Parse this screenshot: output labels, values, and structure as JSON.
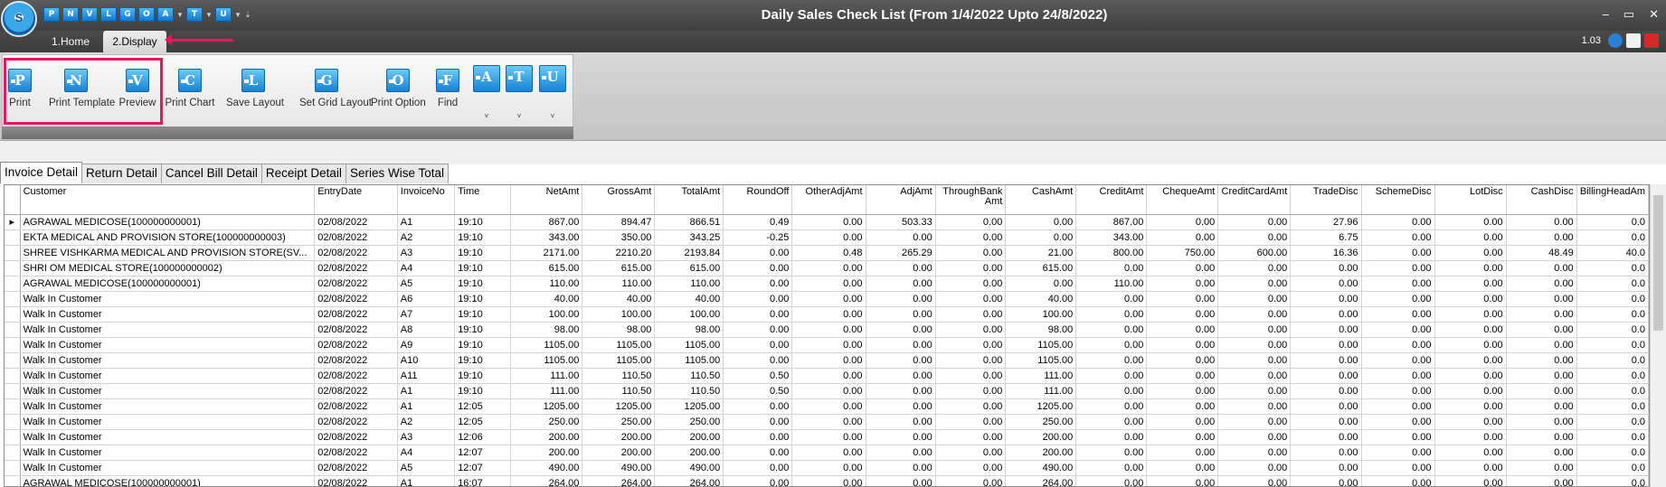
{
  "window": {
    "title": "Daily Sales Check List (From 1/4/2022 Upto 24/8/2022)",
    "logo_text": "S",
    "controls": [
      "–",
      "▭",
      "✕"
    ]
  },
  "quick_access": [
    "P",
    "N",
    "V",
    "L",
    "G",
    "O",
    "A",
    "T",
    "U"
  ],
  "ribbon_tabs": [
    "1.Home",
    "2.Display"
  ],
  "version": "1.03",
  "ribbon_buttons": [
    {
      "letter": "P",
      "label": "Print"
    },
    {
      "letter": "N",
      "label": "Print Template"
    },
    {
      "letter": "V",
      "label": "Preview"
    },
    {
      "letter": "C",
      "label": "Print Chart"
    },
    {
      "letter": "L",
      "label": "Save Layout"
    },
    {
      "letter": "G",
      "label": "Set Grid Layout"
    },
    {
      "letter": "O",
      "label": "Print Option"
    },
    {
      "letter": "F",
      "label": "Find"
    },
    {
      "letter": "A",
      "label": "˅"
    },
    {
      "letter": "T",
      "label": "˅"
    },
    {
      "letter": "U",
      "label": "˅"
    }
  ],
  "doc_tabs": [
    "Invoice Detail",
    "Return Detail",
    "Cancel Bill Detail",
    "Receipt Detail",
    "Series Wise Total"
  ],
  "grid": {
    "columns": [
      "Customer",
      "EntryDate",
      "InvoiceNo",
      "Time",
      "NetAmt",
      "GrossAmt",
      "TotalAmt",
      "RoundOff",
      "OtherAdjAmt",
      "AdjAmt",
      "ThroughBank Amt",
      "CashAmt",
      "CreditAmt",
      "ChequeAmt",
      "CreditCardAmt",
      "TradeDisc",
      "SchemeDisc",
      "LotDisc",
      "CashDisc",
      "BillingHeadAm"
    ],
    "rows": [
      [
        "AGRAWAL MEDICOSE(100000000001)",
        "02/08/2022",
        "A1",
        "19:10",
        "867.00",
        "894.47",
        "866.51",
        "0.49",
        "0.00",
        "503.33",
        "0.00",
        "0.00",
        "867.00",
        "0.00",
        "0.00",
        "27.96",
        "0.00",
        "0.00",
        "0.00",
        "0.0"
      ],
      [
        "EKTA MEDICAL AND PROVISION STORE(100000000003)",
        "02/08/2022",
        "A2",
        "19:10",
        "343.00",
        "350.00",
        "343.25",
        "-0.25",
        "0.00",
        "0.00",
        "0.00",
        "0.00",
        "343.00",
        "0.00",
        "0.00",
        "6.75",
        "0.00",
        "0.00",
        "0.00",
        "0.0"
      ],
      [
        "SHREE VISHKARMA MEDICAL AND PROVISION STORE(SV...",
        "02/08/2022",
        "A3",
        "19:10",
        "2171.00",
        "2210.20",
        "2193.84",
        "0.00",
        "0.48",
        "265.29",
        "0.00",
        "21.00",
        "800.00",
        "750.00",
        "600.00",
        "16.36",
        "0.00",
        "0.00",
        "48.49",
        "40.0"
      ],
      [
        "SHRI OM MEDICAL STORE(100000000002)",
        "02/08/2022",
        "A4",
        "19:10",
        "615.00",
        "615.00",
        "615.00",
        "0.00",
        "0.00",
        "0.00",
        "0.00",
        "615.00",
        "0.00",
        "0.00",
        "0.00",
        "0.00",
        "0.00",
        "0.00",
        "0.00",
        "0.0"
      ],
      [
        "AGRAWAL MEDICOSE(100000000001)",
        "02/08/2022",
        "A5",
        "19:10",
        "110.00",
        "110.00",
        "110.00",
        "0.00",
        "0.00",
        "0.00",
        "0.00",
        "0.00",
        "110.00",
        "0.00",
        "0.00",
        "0.00",
        "0.00",
        "0.00",
        "0.00",
        "0.0"
      ],
      [
        "Walk In Customer",
        "02/08/2022",
        "A6",
        "19:10",
        "40.00",
        "40.00",
        "40.00",
        "0.00",
        "0.00",
        "0.00",
        "0.00",
        "40.00",
        "0.00",
        "0.00",
        "0.00",
        "0.00",
        "0.00",
        "0.00",
        "0.00",
        "0.0"
      ],
      [
        "Walk In Customer",
        "02/08/2022",
        "A7",
        "19:10",
        "100.00",
        "100.00",
        "100.00",
        "0.00",
        "0.00",
        "0.00",
        "0.00",
        "100.00",
        "0.00",
        "0.00",
        "0.00",
        "0.00",
        "0.00",
        "0.00",
        "0.00",
        "0.0"
      ],
      [
        "Walk In Customer",
        "02/08/2022",
        "A8",
        "19:10",
        "98.00",
        "98.00",
        "98.00",
        "0.00",
        "0.00",
        "0.00",
        "0.00",
        "98.00",
        "0.00",
        "0.00",
        "0.00",
        "0.00",
        "0.00",
        "0.00",
        "0.00",
        "0.0"
      ],
      [
        "Walk In Customer",
        "02/08/2022",
        "A9",
        "19:10",
        "1105.00",
        "1105.00",
        "1105.00",
        "0.00",
        "0.00",
        "0.00",
        "0.00",
        "1105.00",
        "0.00",
        "0.00",
        "0.00",
        "0.00",
        "0.00",
        "0.00",
        "0.00",
        "0.0"
      ],
      [
        "Walk In Customer",
        "02/08/2022",
        "A10",
        "19:10",
        "1105.00",
        "1105.00",
        "1105.00",
        "0.00",
        "0.00",
        "0.00",
        "0.00",
        "1105.00",
        "0.00",
        "0.00",
        "0.00",
        "0.00",
        "0.00",
        "0.00",
        "0.00",
        "0.0"
      ],
      [
        "Walk In Customer",
        "02/08/2022",
        "A11",
        "19:10",
        "111.00",
        "110.50",
        "110.50",
        "0.50",
        "0.00",
        "0.00",
        "0.00",
        "111.00",
        "0.00",
        "0.00",
        "0.00",
        "0.00",
        "0.00",
        "0.00",
        "0.00",
        "0.0"
      ],
      [
        "Walk In Customer",
        "02/08/2022",
        "A1",
        "19:10",
        "111.00",
        "110.50",
        "110.50",
        "0.50",
        "0.00",
        "0.00",
        "0.00",
        "111.00",
        "0.00",
        "0.00",
        "0.00",
        "0.00",
        "0.00",
        "0.00",
        "0.00",
        "0.0"
      ],
      [
        "Walk In Customer",
        "02/08/2022",
        "A1",
        "12:05",
        "1205.00",
        "1205.00",
        "1205.00",
        "0.00",
        "0.00",
        "0.00",
        "0.00",
        "1205.00",
        "0.00",
        "0.00",
        "0.00",
        "0.00",
        "0.00",
        "0.00",
        "0.00",
        "0.0"
      ],
      [
        "Walk In Customer",
        "02/08/2022",
        "A2",
        "12:05",
        "250.00",
        "250.00",
        "250.00",
        "0.00",
        "0.00",
        "0.00",
        "0.00",
        "250.00",
        "0.00",
        "0.00",
        "0.00",
        "0.00",
        "0.00",
        "0.00",
        "0.00",
        "0.0"
      ],
      [
        "Walk In Customer",
        "02/08/2022",
        "A3",
        "12:06",
        "200.00",
        "200.00",
        "200.00",
        "0.00",
        "0.00",
        "0.00",
        "0.00",
        "200.00",
        "0.00",
        "0.00",
        "0.00",
        "0.00",
        "0.00",
        "0.00",
        "0.00",
        "0.0"
      ],
      [
        "Walk In Customer",
        "02/08/2022",
        "A4",
        "12:07",
        "200.00",
        "200.00",
        "200.00",
        "0.00",
        "0.00",
        "0.00",
        "0.00",
        "200.00",
        "0.00",
        "0.00",
        "0.00",
        "0.00",
        "0.00",
        "0.00",
        "0.00",
        "0.0"
      ],
      [
        "Walk In Customer",
        "02/08/2022",
        "A5",
        "12:07",
        "490.00",
        "490.00",
        "490.00",
        "0.00",
        "0.00",
        "0.00",
        "0.00",
        "490.00",
        "0.00",
        "0.00",
        "0.00",
        "0.00",
        "0.00",
        "0.00",
        "0.00",
        "0.0"
      ],
      [
        "AGRAWAL MEDICOSE(100000000001)",
        "02/08/2022",
        "A1",
        "16:07",
        "264.00",
        "264.00",
        "264.00",
        "0.00",
        "0.00",
        "0.00",
        "0.00",
        "264.00",
        "0.00",
        "0.00",
        "0.00",
        "0.00",
        "0.00",
        "0.00",
        "0.00",
        "0.0"
      ]
    ]
  },
  "colors": {
    "highlight": "#e8175d",
    "ribbon_icon": "#1582d4"
  }
}
